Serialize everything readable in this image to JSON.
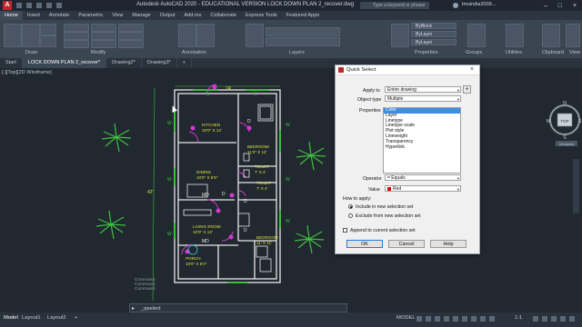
{
  "titlebar": {
    "title": "Autodesk AutoCAD 2020 - EDUCATIONAL VERSION    LOCK DOWN PLAN 2_recover.dwg",
    "search_placeholder": "Type a keyword or phrase",
    "user": "tmsindia2009..."
  },
  "ribbon": {
    "tabs": [
      "Home",
      "Insert",
      "Annotate",
      "Parametric",
      "View",
      "Manage",
      "Output",
      "Add-ins",
      "Collaborate",
      "Express Tools",
      "Featured Apps"
    ],
    "active_tab": "Home",
    "panels": [
      "Draw",
      "Modify",
      "Annotation",
      "Layers",
      "Properties",
      "Groups",
      "Utilities",
      "Clipboard",
      "View"
    ],
    "bylayer": "ByBlock",
    "bylayer2": "ByLayer"
  },
  "doc_tabs": [
    "Start",
    "LOCK DOWN PLAN 2_recover*",
    "Drawing2*",
    "Drawing3*"
  ],
  "viewport": {
    "label": "[-][Top][2D Wireframe]",
    "viewcube": {
      "top": "TOP",
      "n": "N",
      "s": "S",
      "w": "W",
      "e": "E",
      "ucs": "Unnamed"
    }
  },
  "plan": {
    "dim_top": "24'",
    "dim_left": "42'",
    "rooms": [
      {
        "name": "KITCHEN",
        "size": "10'0\" X 12'"
      },
      {
        "name": "BEDROOM",
        "size": "11'3\" X 12'"
      },
      {
        "name": "TOILET",
        "size": "7' X 4'"
      },
      {
        "name": "TOILET",
        "size": "7' X 4'"
      },
      {
        "name": "DINING",
        "size": "10'0\" X 6'5\""
      },
      {
        "name": "LIVING ROOM",
        "size": "10'0\" X 12'"
      },
      {
        "name": "BEDROOM",
        "size": "11' X 11'"
      },
      {
        "name": "PORCH",
        "size": "10'0\" X 8'0\""
      }
    ],
    "tags": [
      "MD",
      "MD",
      "D",
      "D",
      "D",
      "D"
    ],
    "w_marks": [
      "W",
      "W",
      "W",
      "W",
      "W",
      "W",
      "W",
      "W"
    ]
  },
  "cmdline": {
    "history": [
      "Command:",
      "Command:",
      "Command:"
    ],
    "current": "_qselect"
  },
  "statusbar": {
    "tabs": [
      "Model",
      "Layout1",
      "Layout2"
    ],
    "active": "Model",
    "model_label": "MODEL",
    "scale": "1:1"
  },
  "dialog": {
    "title": "Quick Select",
    "apply_to_label": "Apply to",
    "apply_to_value": "Entire drawing",
    "object_type_label": "Object type",
    "object_type_value": "Multiple",
    "properties_label": "Properties",
    "properties": [
      "Color",
      "Layer",
      "Linetype",
      "Linetype scale",
      "Plot style",
      "Lineweight",
      "Transparency",
      "Hyperlink"
    ],
    "selected_property": "Color",
    "operator_label": "Operator",
    "operator_value": "= Equals",
    "value_label": "Value",
    "value_value": "Red",
    "how_to_apply_label": "How to apply:",
    "include_label": "Include in new selection set",
    "exclude_label": "Exclude from new selection set",
    "append_label": "Append to current selection set",
    "ok": "OK",
    "cancel": "Cancel",
    "help": "Help",
    "include_selected": true,
    "append_checked": false
  }
}
